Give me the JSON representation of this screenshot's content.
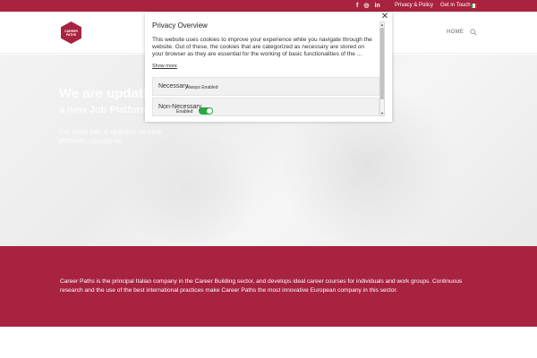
{
  "topbar": {
    "background": "#a8233f",
    "social_icons": [
      {
        "icon": "facebook-icon",
        "glyph": "f"
      },
      {
        "icon": "instagram-icon",
        "glyph": "◎"
      },
      {
        "icon": "linkedin-icon",
        "glyph": "in"
      }
    ],
    "links": [
      "Privacy & Policy",
      "Get in Touch"
    ],
    "language_flag": {
      "icon": "italy-flag-icon",
      "colors": [
        "#009246",
        "#ffffff",
        "#ce2b37"
      ]
    }
  },
  "header": {
    "logo_line1": "CAREER",
    "logo_line2": "PATHS",
    "nav": {
      "home_label": "HOME",
      "search_icon": "search-icon"
    }
  },
  "hero": {
    "title": "We are updating",
    "subtitle": "a new Job Platform",
    "line1": "For more info & updates on new",
    "line2": "platform, contact us"
  },
  "band": {
    "background": "#a8233f",
    "text": "Career Paths is the principal Italian company in the Career Building sector, and develops ideal career courses for individuals and work groups. Continuous research and the use of the best international practices make Career Paths the most innovative European company in this sector."
  },
  "privacy_modal": {
    "title": "Privacy Overview",
    "body": "This website uses cookies to improve your experience while you navigate through the website. Out of these, the cookies that are categorized as necessary are stored on your browser as they are essential for the working of basic functionalities of the ...",
    "show_more": "Show more",
    "close_glyph": "✕",
    "categories": [
      {
        "label": "Necessary",
        "status": "Always Enabled"
      },
      {
        "label": "Non-Necessary",
        "status": "Enabled",
        "toggle_on": true
      }
    ],
    "toggle_color": "#28a745"
  }
}
